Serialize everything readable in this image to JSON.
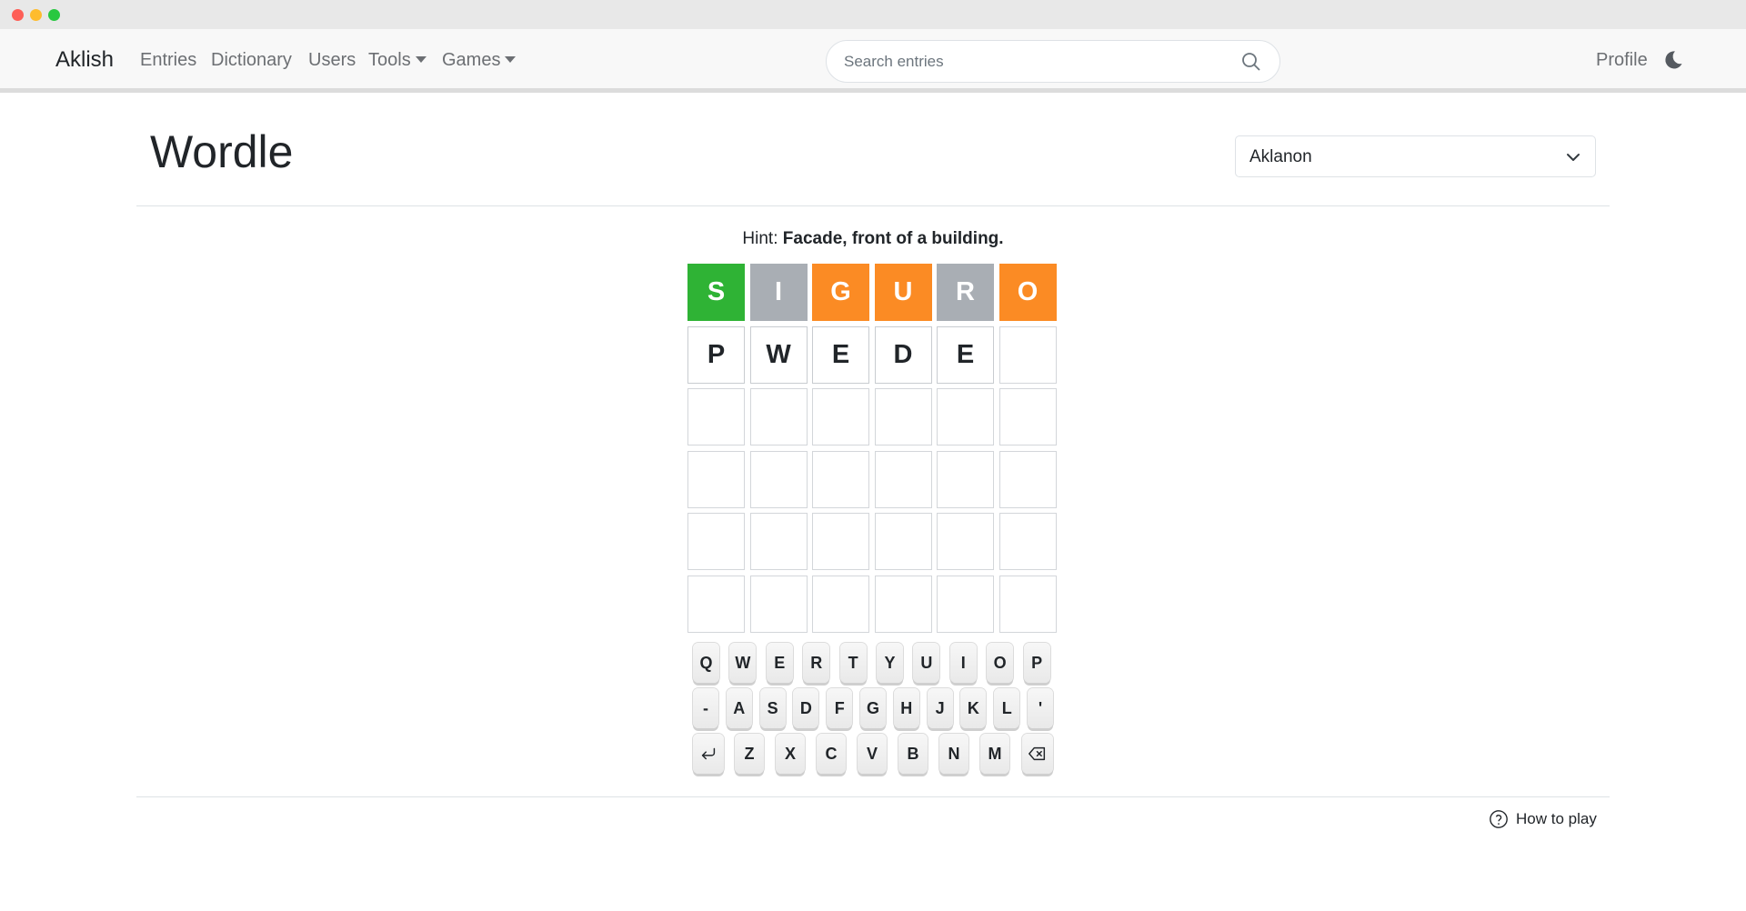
{
  "navbar": {
    "brand": "Aklish",
    "links": [
      "Entries",
      "Dictionary",
      "Users"
    ],
    "tools": "Tools",
    "games": "Games",
    "search_placeholder": "Search entries",
    "profile": "Profile"
  },
  "page": {
    "title": "Wordle",
    "language": "Aklanon"
  },
  "hint": {
    "label": "Hint:",
    "text": "Facade, front of a building."
  },
  "board": {
    "rows": [
      [
        "S",
        "I",
        "G",
        "U",
        "R",
        "O"
      ],
      [
        "P",
        "W",
        "E",
        "D",
        "E",
        ""
      ],
      [
        "",
        "",
        "",
        "",
        "",
        ""
      ],
      [
        "",
        "",
        "",
        "",
        "",
        ""
      ],
      [
        "",
        "",
        "",
        "",
        "",
        ""
      ],
      [
        "",
        "",
        "",
        "",
        "",
        ""
      ]
    ],
    "states": [
      [
        "correct",
        "absent",
        "present",
        "present",
        "absent",
        "present"
      ],
      [
        "typed",
        "typed",
        "typed",
        "typed",
        "typed",
        "empty"
      ],
      [
        "empty",
        "empty",
        "empty",
        "empty",
        "empty",
        "empty"
      ],
      [
        "empty",
        "empty",
        "empty",
        "empty",
        "empty",
        "empty"
      ],
      [
        "empty",
        "empty",
        "empty",
        "empty",
        "empty",
        "empty"
      ],
      [
        "empty",
        "empty",
        "empty",
        "empty",
        "empty",
        "empty"
      ]
    ],
    "colors": {
      "correct": "#2fb335",
      "present": "#fb8b24",
      "absent": "#a9aeb4"
    }
  },
  "keyboard": {
    "row1": [
      "Q",
      "W",
      "E",
      "R",
      "T",
      "Y",
      "U",
      "I",
      "O",
      "P"
    ],
    "row2": [
      "-",
      "A",
      "S",
      "D",
      "F",
      "G",
      "H",
      "J",
      "K",
      "L",
      "'"
    ],
    "row3_letters": [
      "Z",
      "X",
      "C",
      "V",
      "B",
      "N",
      "M"
    ],
    "enter_icon": "enter-icon",
    "backspace_icon": "backspace-icon"
  },
  "footer": {
    "how_to_play": "How to play"
  }
}
